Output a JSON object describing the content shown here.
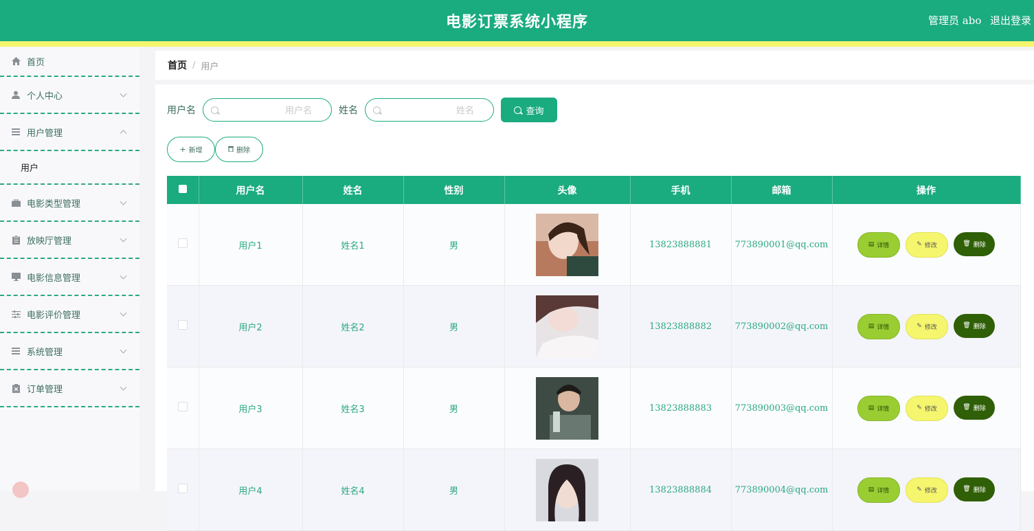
{
  "header": {
    "title": "电影订票系统小程序",
    "user": "管理员 abo",
    "logout": "退出登录",
    "colors": {
      "bar": "#1aab7f",
      "stripe": "#f5f56e"
    }
  },
  "sidebar": {
    "items": [
      {
        "label": "首页",
        "icon": "home-icon"
      },
      {
        "label": "个人中心",
        "icon": "person-icon",
        "chevron": "down"
      },
      {
        "label": "用户管理",
        "icon": "list-icon",
        "chevron": "up"
      },
      {
        "label": "电影类型管理",
        "icon": "briefcase-icon",
        "chevron": "down"
      },
      {
        "label": "放映厅管理",
        "icon": "clipboard-icon",
        "chevron": "down"
      },
      {
        "label": "电影信息管理",
        "icon": "monitor-icon",
        "chevron": "down"
      },
      {
        "label": "电影评价管理",
        "icon": "sliders-icon",
        "chevron": "down"
      },
      {
        "label": "系统管理",
        "icon": "list-icon",
        "chevron": "down"
      },
      {
        "label": "订单管理",
        "icon": "delete-doc-icon",
        "chevron": "down"
      }
    ],
    "sub_item": "用户"
  },
  "breadcrumb": {
    "home": "首页",
    "sep": "/",
    "current": "用户"
  },
  "search": {
    "username_label": "用户名",
    "username_placeholder": "用户名",
    "name_label": "姓名",
    "name_placeholder": "姓名",
    "query_button": "查询"
  },
  "actions": {
    "add": "新增",
    "delete": "删除"
  },
  "table": {
    "headers": [
      "用户名",
      "姓名",
      "性别",
      "头像",
      "手机",
      "邮箱",
      "操作"
    ],
    "op_labels": {
      "detail": "详情",
      "edit": "修改",
      "delete": "删除"
    },
    "rows": [
      {
        "username": "用户1",
        "name": "姓名1",
        "gender": "男",
        "phone": "13823888881",
        "email": "773890001@qq.com"
      },
      {
        "username": "用户2",
        "name": "姓名2",
        "gender": "男",
        "phone": "13823888882",
        "email": "773890002@qq.com"
      },
      {
        "username": "用户3",
        "name": "姓名3",
        "gender": "男",
        "phone": "13823888883",
        "email": "773890003@qq.com"
      },
      {
        "username": "用户4",
        "name": "姓名4",
        "gender": "男",
        "phone": "13823888884",
        "email": "773890004@qq.com"
      }
    ]
  }
}
